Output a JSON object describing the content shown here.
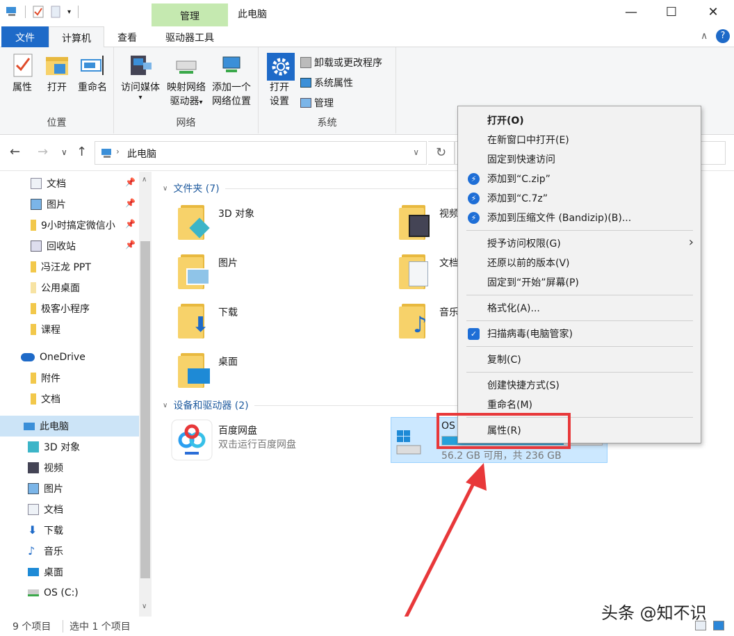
{
  "window": {
    "title": "此电脑",
    "tool_tab": "管理",
    "min": "—",
    "max": "☐",
    "close": "✕"
  },
  "tabs": {
    "file": "文件",
    "computer": "计算机",
    "view": "查看",
    "drive_tools": "驱动器工具"
  },
  "ribbon": {
    "location_group": "位置",
    "network_group": "网络",
    "system_group": "系统",
    "properties": "属性",
    "open": "打开",
    "rename": "重命名",
    "media_line1": "访问媒体",
    "map_line1": "映射网络",
    "map_line2": "驱动器",
    "add_line1": "添加一个",
    "add_line2": "网络位置",
    "settings_line1": "打开",
    "settings_line2": "设置",
    "uninstall": "卸载或更改程序",
    "sysprops": "系统属性",
    "manage": "管理"
  },
  "address": {
    "path": "此电脑"
  },
  "nav": {
    "items": [
      {
        "label": "文档"
      },
      {
        "label": "图片"
      },
      {
        "label": "9小时搞定微信小"
      },
      {
        "label": "回收站"
      },
      {
        "label": "冯汪龙 PPT"
      },
      {
        "label": "公用桌面"
      },
      {
        "label": "极客小程序"
      },
      {
        "label": "课程"
      },
      {
        "label": "OneDrive"
      },
      {
        "label": "附件"
      },
      {
        "label": "文档"
      },
      {
        "label": "此电脑"
      },
      {
        "label": "3D 对象"
      },
      {
        "label": "视频"
      },
      {
        "label": "图片"
      },
      {
        "label": "文档"
      },
      {
        "label": "下载"
      },
      {
        "label": "音乐"
      },
      {
        "label": "桌面"
      },
      {
        "label": "OS (C:)"
      }
    ]
  },
  "content": {
    "folders_header": "文件夹 (7)",
    "drives_header": "设备和驱动器 (2)",
    "folders": [
      {
        "label": "3D 对象"
      },
      {
        "label": "视频"
      },
      {
        "label": "图片"
      },
      {
        "label": "文档"
      },
      {
        "label": "下载"
      },
      {
        "label": "音乐"
      },
      {
        "label": "桌面"
      }
    ],
    "baidu_name": "百度网盘",
    "baidu_sub": "双击运行百度网盘",
    "os_name": "OS",
    "os_sub": "56.2 GB 可用，共 236 GB"
  },
  "context_menu": {
    "items": [
      {
        "label": "打开(O)"
      },
      {
        "label": "在新窗口中打开(E)"
      },
      {
        "label": "固定到快速访问"
      },
      {
        "label": "添加到“C.zip”"
      },
      {
        "label": "添加到“C.7z”"
      },
      {
        "label": "添加到压缩文件 (Bandizip)(B)..."
      },
      {
        "label": "授予访问权限(G)"
      },
      {
        "label": "还原以前的版本(V)"
      },
      {
        "label": "固定到“开始”屏幕(P)"
      },
      {
        "label": "格式化(A)..."
      },
      {
        "label": "扫描病毒(电脑管家)"
      },
      {
        "label": "复制(C)"
      },
      {
        "label": "创建快捷方式(S)"
      },
      {
        "label": "重命名(M)"
      },
      {
        "label": "属性(R)"
      }
    ]
  },
  "status": {
    "count": "9 个项目",
    "selected": "选中 1 个项目"
  },
  "watermark": "头条 @知不识",
  "colors": {
    "accent": "#1e6ac8",
    "tool_tab": "#c5e9b0",
    "selection": "#cce8ff",
    "highlight_box": "#e8383a",
    "arrow": "#e8383a"
  }
}
